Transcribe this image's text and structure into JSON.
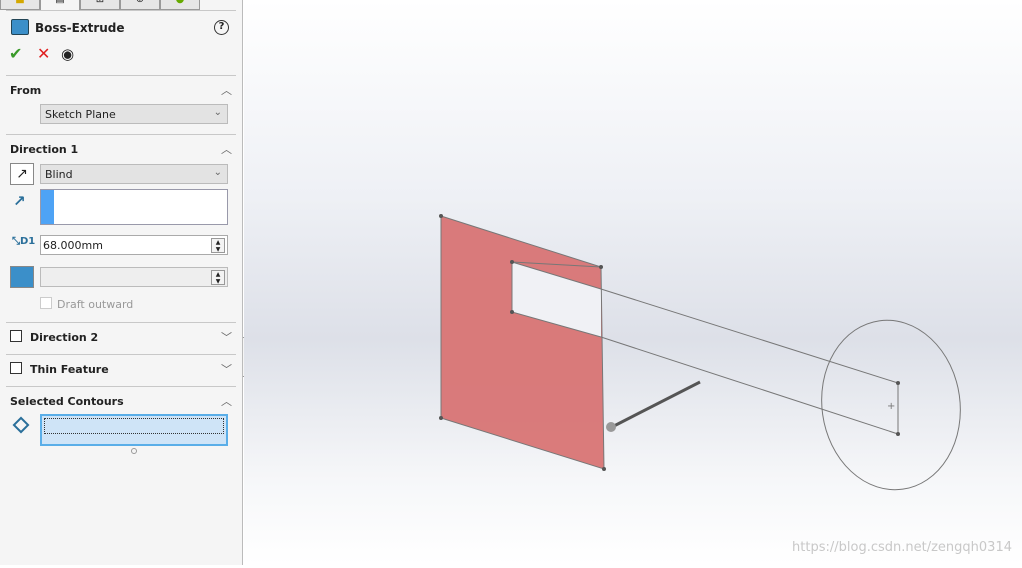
{
  "feature": {
    "title": "Boss-Extrude",
    "help_icon": "question-icon",
    "ok_icon": "check-icon",
    "cancel_icon": "x-icon",
    "preview_icon": "eye-icon"
  },
  "from": {
    "label": "From",
    "value": "Sketch Plane"
  },
  "direction1": {
    "label": "Direction 1",
    "end_condition": "Blind",
    "depth": "68.000mm",
    "draft_value": "",
    "draft_outward": "Draft outward"
  },
  "direction2": {
    "label": "Direction 2"
  },
  "thin_feature": {
    "label": "Thin Feature"
  },
  "selected_contours": {
    "label": "Selected Contours"
  },
  "watermark": "https://blog.csdn.net/zengqh0314",
  "colors": {
    "face": "#d87474",
    "accent": "#4ea3f5",
    "ok": "#3a9a2a",
    "cancel": "#e02020"
  }
}
